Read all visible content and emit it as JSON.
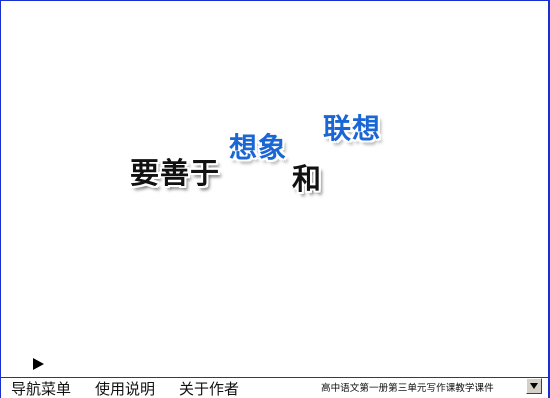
{
  "slide": {
    "phrase_main": "要善于",
    "word_imagine": "想象",
    "word_and": "和",
    "word_associate": "联想"
  },
  "nav": {
    "items": [
      {
        "label": "导航菜单"
      },
      {
        "label": "使用说明"
      },
      {
        "label": "关于作者"
      }
    ]
  },
  "course_title": "高中语文第一册第三单元写作课教学课件",
  "colors": {
    "border": "#1a2fd0",
    "accent_blue": "#1a66d4",
    "text": "#111111"
  },
  "icons": {
    "play": "play-triangle-icon",
    "dropdown": "chevron-down-icon"
  }
}
